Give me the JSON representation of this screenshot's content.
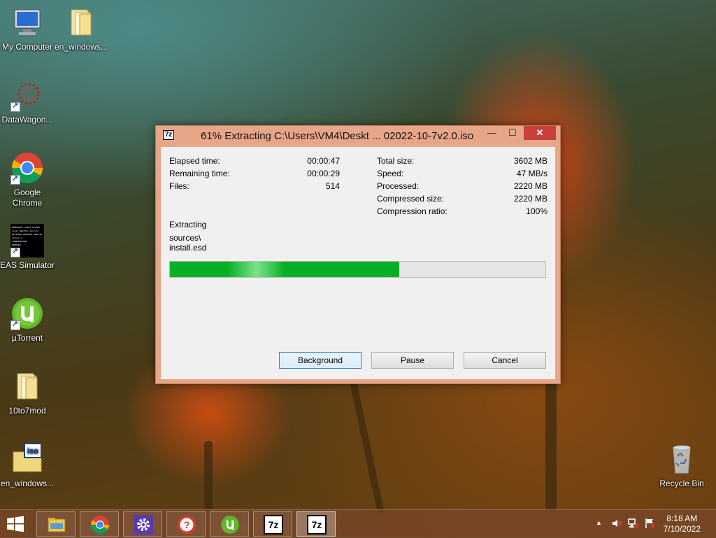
{
  "desktop": {
    "icons": [
      {
        "label": "My Computer"
      },
      {
        "label": "en_windows..."
      },
      {
        "label": "DataWagon..."
      },
      {
        "label": "Google Chrome"
      },
      {
        "label": "EAS Simulator"
      },
      {
        "label": "µTorrent"
      },
      {
        "label": "10to7mod"
      },
      {
        "label": "en_windows..."
      },
      {
        "label": "Recycle Bin"
      }
    ],
    "eas_thumb_text": "EMERGENCY ALERT SYSTEM\nLocal Weather Service\nNATIONAL WEATHER SERVICE\nissued a\nTHUNDERSTORM\nWARNING"
  },
  "window": {
    "title": "61% Extracting C:\\Users\\VM4\\Deskt ... 02022-10-7v2.0.iso",
    "app_icon": "7z",
    "controls": {
      "minimize": "—",
      "maximize": "☐",
      "close": "✕"
    },
    "stats_left": [
      {
        "label": "Elapsed time:",
        "value": "00:00:47"
      },
      {
        "label": "Remaining time:",
        "value": "00:00:29"
      },
      {
        "label": "Files:",
        "value": "514"
      }
    ],
    "stats_right": [
      {
        "label": "Total size:",
        "value": "3602 MB"
      },
      {
        "label": "Speed:",
        "value": "47 MB/s"
      },
      {
        "label": "Processed:",
        "value": "2220 MB"
      },
      {
        "label": "Compressed size:",
        "value": "2220 MB"
      },
      {
        "label": "Compression ratio:",
        "value": "100%"
      }
    ],
    "action": "Extracting",
    "current_path": "sources\\",
    "current_file": "install.esd",
    "progress_percent": 61,
    "buttons": {
      "background": "Background",
      "pause": "Pause",
      "cancel": "Cancel"
    }
  },
  "taskbar": {
    "apps": [
      {
        "name": "file-explorer",
        "label": ""
      },
      {
        "name": "chrome",
        "label": ""
      },
      {
        "name": "settings",
        "label": ""
      },
      {
        "name": "help",
        "label": ""
      },
      {
        "name": "utorrent",
        "label": ""
      },
      {
        "name": "7zip",
        "label": "7z"
      },
      {
        "name": "7zip-active",
        "label": "7z"
      }
    ],
    "time": "8:18 AM",
    "date": "7/10/2022"
  },
  "colors": {
    "accent_progress": "#06b025",
    "close_button": "#c7403a",
    "window_frame": "#e8a688"
  }
}
